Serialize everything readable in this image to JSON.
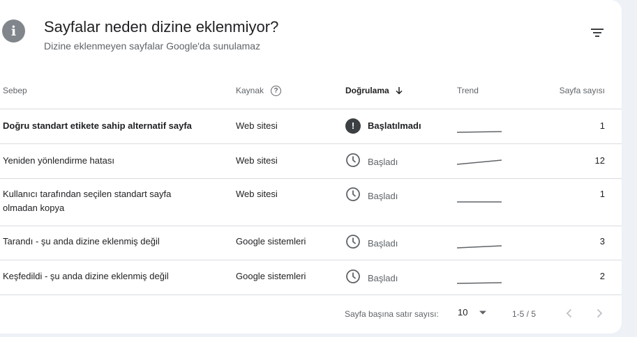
{
  "header": {
    "title": "Sayfalar neden dizine eklenmiyor?",
    "subtitle": "Dizine eklenmeyen sayfalar Google'da sunulamaz"
  },
  "table": {
    "columns": {
      "reason": "Sebep",
      "source": "Kaynak",
      "validation": "Doğrulama",
      "trend": "Trend",
      "count": "Sayfa sayısı"
    },
    "rows": [
      {
        "reason": "Doğru standart etikete sahip alternatif sayfa",
        "source": "Web sitesi",
        "validation": "Başlatılmadı",
        "status": "alert",
        "count": "1"
      },
      {
        "reason": "Yeniden yönlendirme hatası",
        "source": "Web sitesi",
        "validation": "Başladı",
        "status": "clock",
        "count": "12"
      },
      {
        "reason": "Kullanıcı tarafından seçilen standart sayfa olmadan kopya",
        "source": "Web sitesi",
        "validation": "Başladı",
        "status": "clock",
        "count": "1"
      },
      {
        "reason": "Tarandı - şu anda dizine eklenmiş değil",
        "source": "Google sistemleri",
        "validation": "Başladı",
        "status": "clock",
        "count": "3"
      },
      {
        "reason": "Keşfedildi - şu anda dizine eklenmiş değil",
        "source": "Google sistemleri",
        "validation": "Başladı",
        "status": "clock",
        "count": "2"
      }
    ]
  },
  "footer": {
    "rows_per_page_label": "Sayfa başına satır sayısı:",
    "rows_per_page": "10",
    "range": "1-5 / 5"
  },
  "icons": {
    "info": "info-icon",
    "filter": "filter-icon",
    "help": "help-circle-icon",
    "sort": "arrow-down-icon",
    "alert": "alert-icon",
    "clock": "clock-icon",
    "prev": "chevron-left-icon",
    "next": "chevron-right-icon"
  },
  "colors": {
    "card": "#ffffff",
    "background": "#eef1f6",
    "border": "#dadce0",
    "muted": "#5f6368"
  }
}
